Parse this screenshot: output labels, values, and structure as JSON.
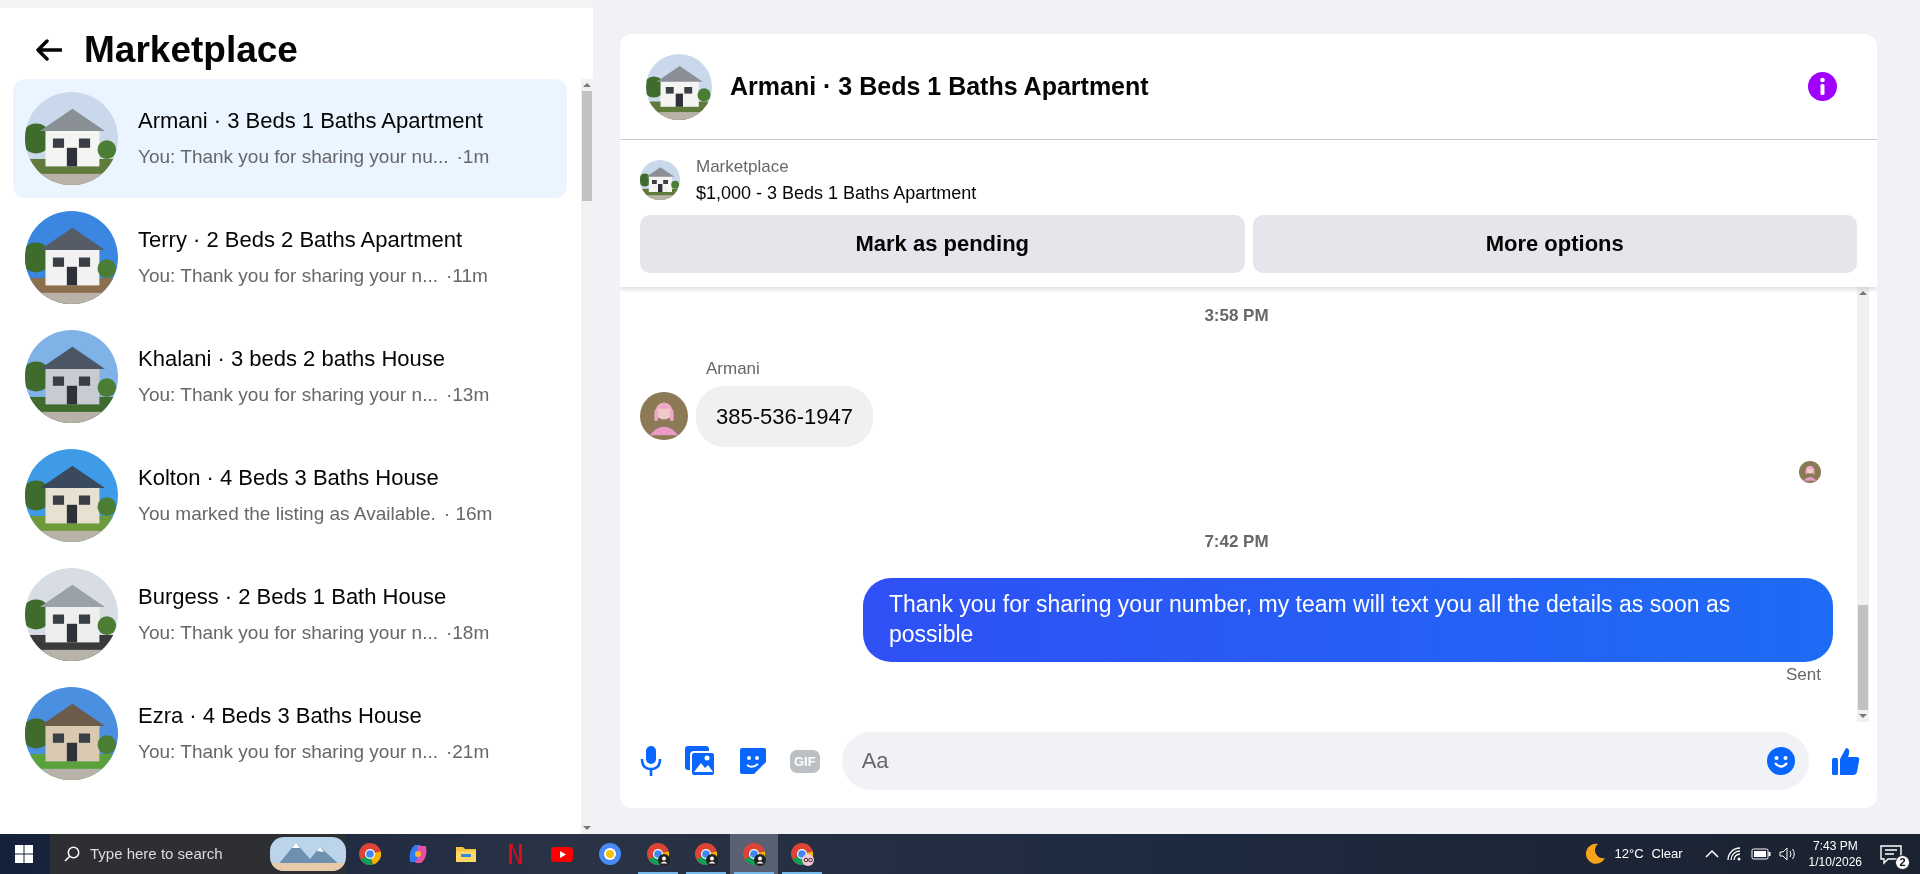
{
  "sidebar": {
    "title": "Marketplace",
    "conversations": [
      {
        "name": "Armani · 3 Beds 1 Baths Apartment",
        "preview": "You: Thank you for sharing your nu...",
        "time": "·1m",
        "selected": true
      },
      {
        "name": "Terry · 2 Beds 2 Baths Apartment",
        "preview": "You: Thank you for sharing your n...",
        "time": "·11m",
        "selected": false
      },
      {
        "name": "Khalani · 3 beds 2 baths House",
        "preview": "You: Thank you for sharing your n...",
        "time": "·13m",
        "selected": false
      },
      {
        "name": "Kolton · 4 Beds 3 Baths House",
        "preview": "You marked the listing as Available.",
        "time": "· 16m",
        "selected": false
      },
      {
        "name": "Burgess · 2 Beds 1 Bath House",
        "preview": "You: Thank you for sharing your n...",
        "time": "·18m",
        "selected": false
      },
      {
        "name": "Ezra · 4 Beds 3 Baths House",
        "preview": "You: Thank you for sharing your n...",
        "time": "·21m",
        "selected": false
      }
    ]
  },
  "chat": {
    "title": "Armani · 3 Beds 1 Baths Apartment",
    "listing": {
      "label": "Marketplace",
      "summary": "$1,000 - 3 Beds 1 Baths Apartment"
    },
    "actions": [
      "Mark as pending",
      "More options"
    ],
    "messages": [
      {
        "kind": "timestamp",
        "text": "3:58 PM"
      },
      {
        "kind": "received",
        "sender": "Armani",
        "text": "385-536-1947"
      },
      {
        "kind": "read_receipt"
      },
      {
        "kind": "timestamp",
        "text": "7:42 PM"
      },
      {
        "kind": "sent",
        "text": "Thank you for  sharing your number, my team will text you all the details as soon as possible",
        "status": "Sent"
      }
    ],
    "composer": {
      "gif_label": "GIF",
      "placeholder": "Aa"
    }
  },
  "taskbar": {
    "search_placeholder": "Type here to search",
    "apps": [
      {
        "kind": "chrome",
        "running": false,
        "selected": false
      },
      {
        "kind": "copilot",
        "running": false,
        "selected": false
      },
      {
        "kind": "folder",
        "running": false,
        "selected": false
      },
      {
        "kind": "netflix",
        "running": false,
        "selected": false
      },
      {
        "kind": "youtube",
        "running": false,
        "selected": false
      },
      {
        "kind": "chrome-plain",
        "running": false,
        "selected": false
      },
      {
        "kind": "chrome-profile",
        "running": true,
        "selected": false
      },
      {
        "kind": "chrome-profile",
        "running": true,
        "selected": false
      },
      {
        "kind": "chrome-profile",
        "running": true,
        "selected": true
      },
      {
        "kind": "chrome-glasses",
        "running": true,
        "selected": false
      }
    ],
    "weather": {
      "temperature": "12°C",
      "condition": "Clear"
    },
    "time": "7:43 PM",
    "date": "1/10/2026",
    "notifications": "2"
  }
}
